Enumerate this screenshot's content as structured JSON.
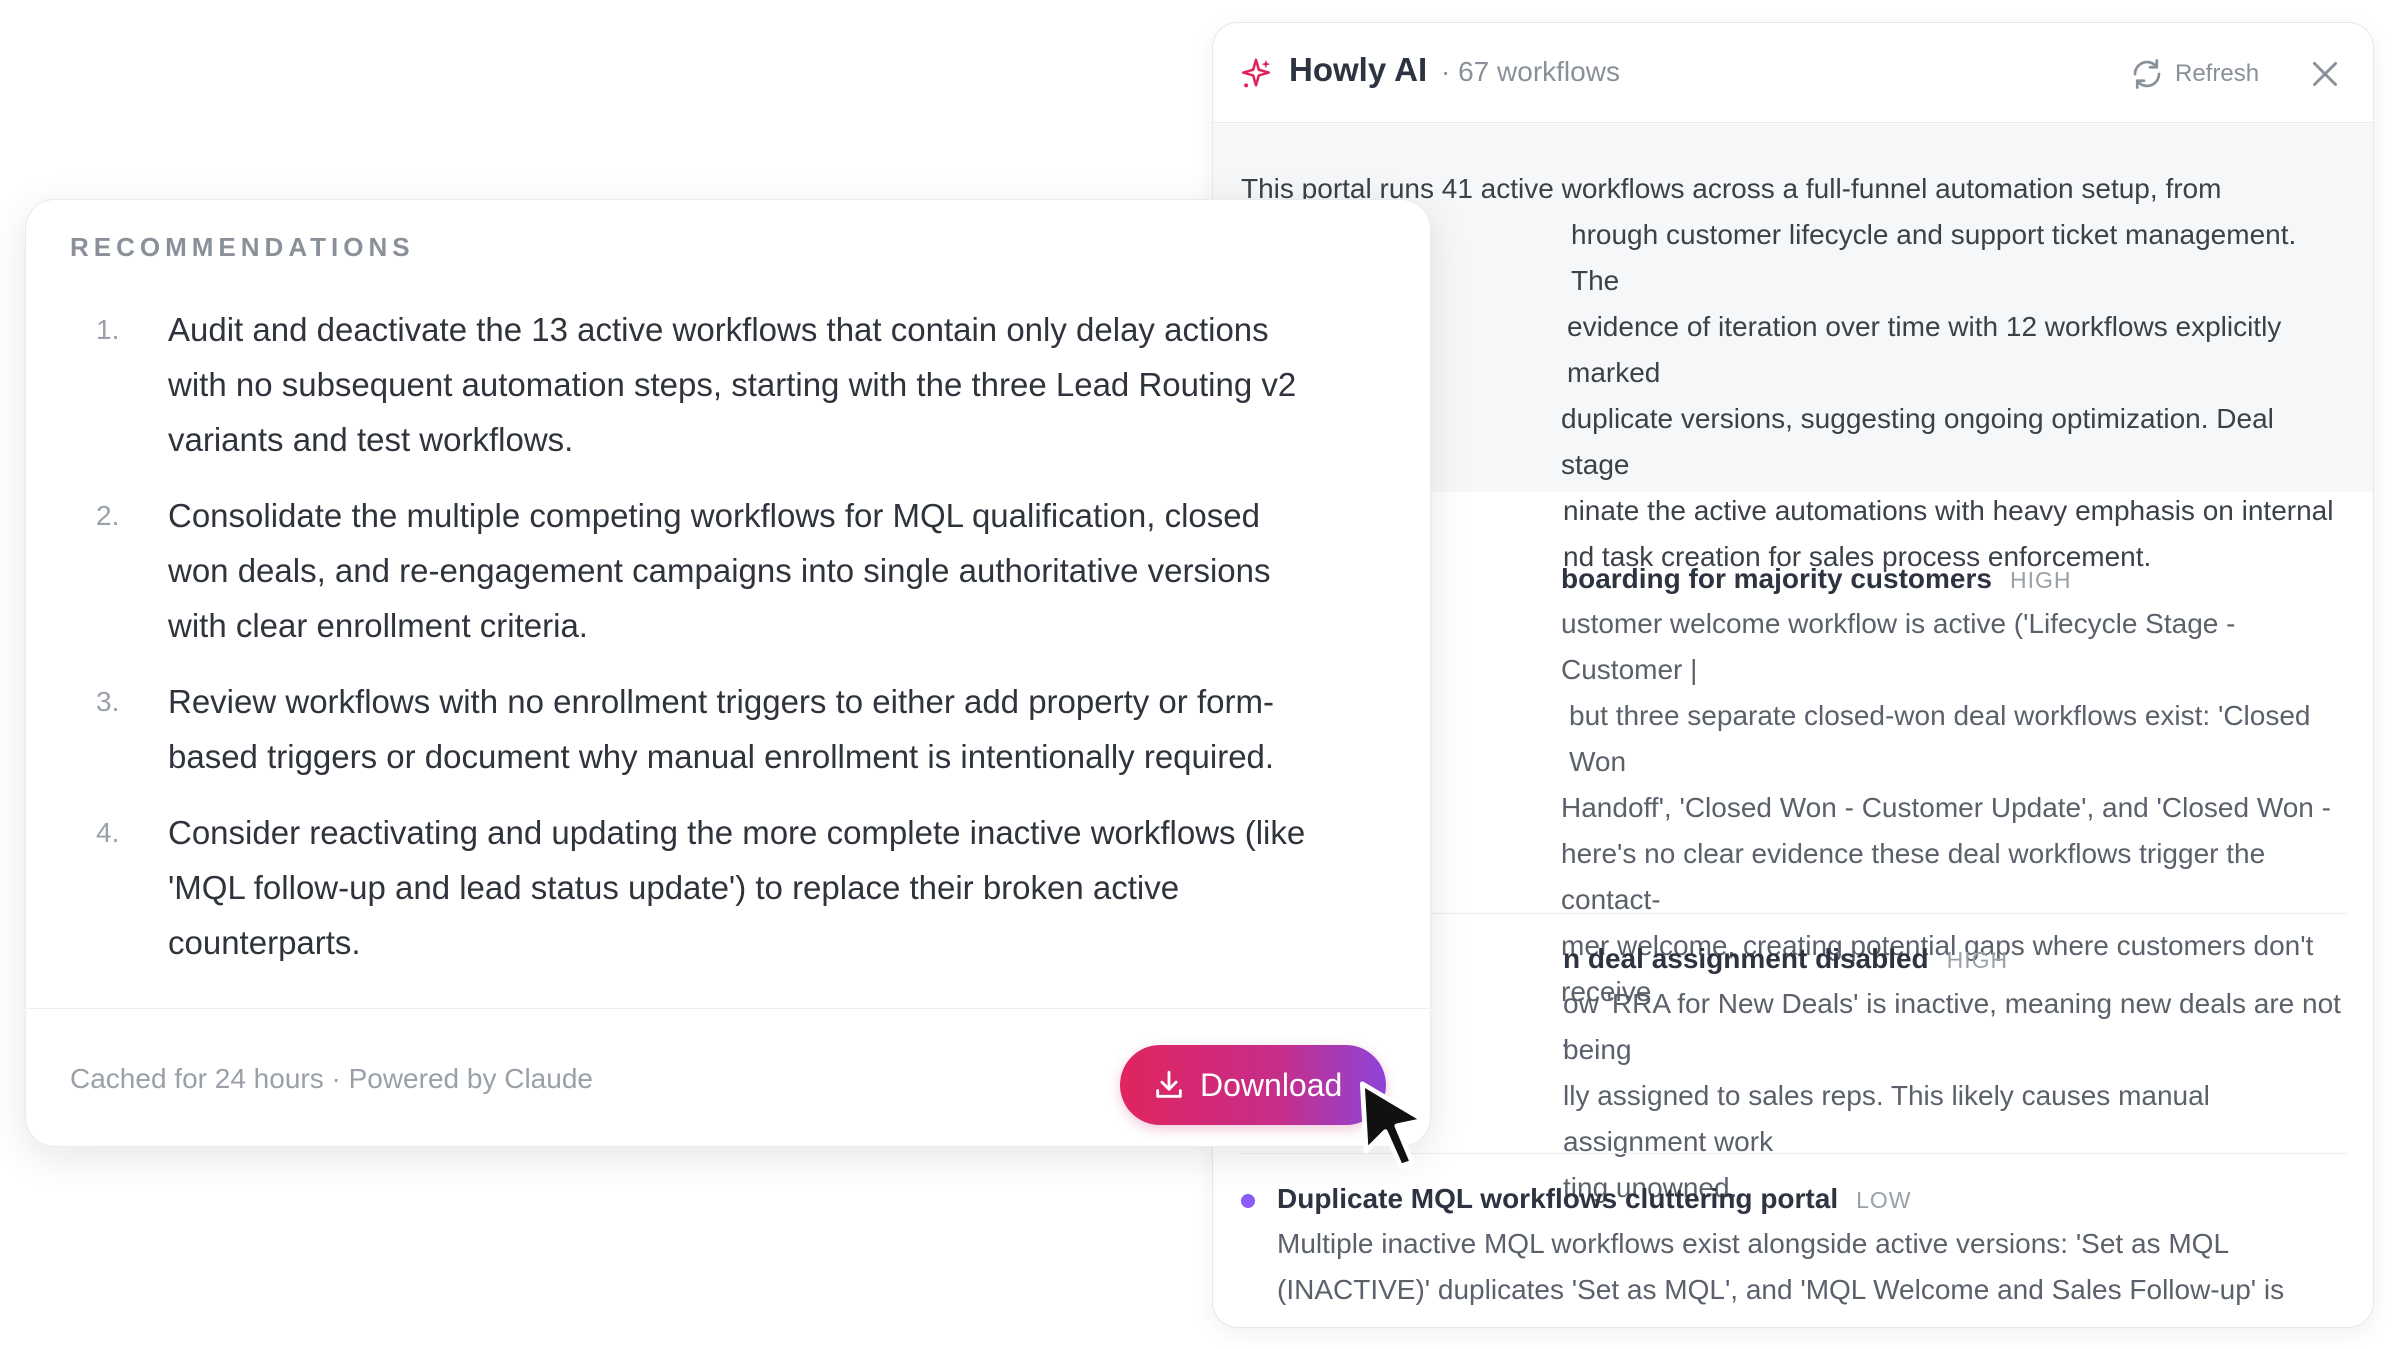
{
  "panel": {
    "title": "Howly AI",
    "count": "· 67 workflows",
    "refresh_label": "Refresh",
    "summary_lines": [
      "This portal runs 41 active workflows across a full-funnel automation setup, from",
      "hrough customer lifecycle and support ticket management. The",
      "evidence of iteration over time with 12 workflows explicitly marked",
      "duplicate versions, suggesting ongoing optimization. Deal stage",
      "ninate the active automations with heavy emphasis on internal",
      "nd task creation for sales process enforcement."
    ],
    "issues": [
      {
        "title": "boarding for majority customers",
        "severity": "HIGH",
        "lines": [
          "ustomer welcome workflow is active ('Lifecycle Stage - Customer |",
          "but three separate closed-won deal workflows exist: 'Closed Won",
          "Handoff', 'Closed Won - Customer Update', and 'Closed Won -",
          "here's no clear evidence these deal workflows trigger the contact-",
          "mer welcome, creating potential gaps where customers don't receive",
          "."
        ]
      },
      {
        "title": "n deal assignment disabled",
        "severity": "HIGH",
        "lines": [
          "ow 'RRA for New Deals' is inactive, meaning new deals are not being",
          "lly assigned to sales reps. This likely causes manual assignment work",
          "ting unowned."
        ]
      },
      {
        "title": "Duplicate MQL workflows cluttering portal",
        "severity": "LOW",
        "lines": [
          "Multiple inactive MQL workflows exist alongside active versions: 'Set as MQL",
          "(INACTIVE)' duplicates 'Set as MQL', and 'MQL Welcome and Sales Follow-up' is"
        ]
      }
    ]
  },
  "recommendations": {
    "heading": "RECOMMENDATIONS",
    "items": [
      {
        "num": "1.",
        "lines": [
          "Audit and deactivate the 13 active workflows that contain only delay actions",
          "with no subsequent automation steps, starting with the three Lead Routing v2",
          "variants and test workflows."
        ]
      },
      {
        "num": "2.",
        "lines": [
          "Consolidate the multiple competing workflows for MQL qualification, closed",
          "won deals, and re-engagement campaigns into single authoritative versions",
          "with clear enrollment criteria."
        ]
      },
      {
        "num": "3.",
        "lines": [
          "Review workflows with no enrollment triggers to either add property or form-",
          "based triggers or document why manual enrollment is intentionally required."
        ]
      },
      {
        "num": "4.",
        "lines": [
          "Consider reactivating and updating the more complete inactive workflows (like",
          "'MQL follow-up and lead status update') to replace their broken active",
          "counterparts."
        ]
      }
    ],
    "footer_note": "Cached for 24 hours · Powered by Claude",
    "download_label": "Download"
  },
  "icons": {
    "sparkle": "sparkle-icon",
    "refresh": "refresh-icon",
    "close": "close-icon",
    "download": "download-icon",
    "cursor": "cursor-icon",
    "bullet": "bullet-dot"
  },
  "colors": {
    "accent_pink": "#e0245e",
    "accent_purple": "#8e44d8",
    "bullet": "#8b5cf6",
    "summary_bg": "#f6f7f8"
  }
}
